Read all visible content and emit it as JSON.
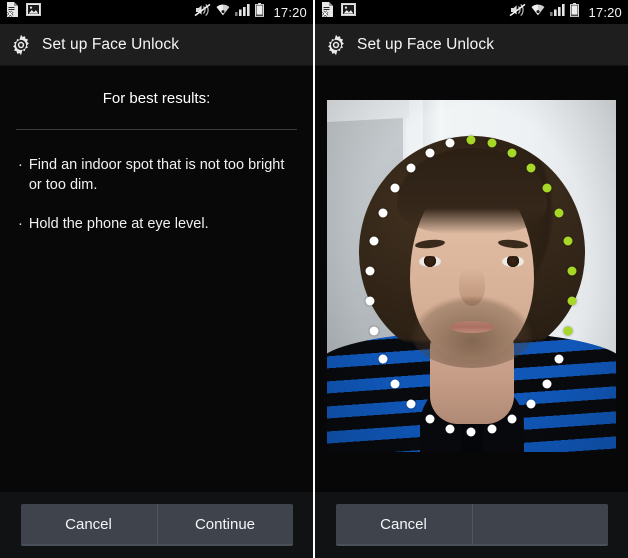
{
  "screens": [
    {
      "id": "instructions",
      "statusbar": {
        "left_icons": [
          "document-error-icon",
          "image-icon"
        ],
        "right_icons": [
          "vibrate-mute-icon",
          "wifi-icon",
          "cellular-signal-icon",
          "battery-icon"
        ],
        "time": "17:20"
      },
      "titlebar": {
        "icon": "gear-icon",
        "title": "Set up Face Unlock"
      },
      "body": {
        "heading": "For best results:",
        "bullet_marker": "·",
        "bullets": [
          "Find an indoor spot that is not too bright or too dim.",
          "Hold the phone at eye level."
        ]
      },
      "buttons": {
        "primary": "Cancel",
        "secondary": "Continue"
      }
    },
    {
      "id": "capture",
      "statusbar": {
        "left_icons": [
          "document-error-icon",
          "image-icon"
        ],
        "right_icons": [
          "vibrate-mute-icon",
          "wifi-icon",
          "cellular-signal-icon",
          "battery-icon"
        ],
        "time": "17:20"
      },
      "titlebar": {
        "icon": "gear-icon",
        "title": "Set up Face Unlock"
      },
      "preview": {
        "label": "camera-preview",
        "subject": "man with curly dark hair in blue and black striped sweater",
        "dot_colors": {
          "pending": "#ffffff",
          "captured": "#a7d828"
        },
        "dot_count": 30,
        "captured_count": 10
      },
      "buttons": {
        "primary": "Cancel",
        "secondary": ""
      }
    }
  ],
  "theme": {
    "status_bg": "#000000",
    "title_bg": "#1e1e1e",
    "content_bg": "#080808",
    "button_bg": "#3e434c",
    "text": "#f4f5f6",
    "accent_green": "#a7d828"
  }
}
